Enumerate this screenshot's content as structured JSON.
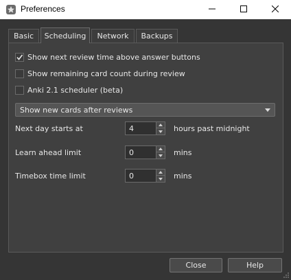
{
  "window": {
    "title": "Preferences",
    "icon": "anki-app-icon",
    "controls": [
      "minimize-icon",
      "maximize-icon",
      "close-icon"
    ]
  },
  "tabs": [
    {
      "label": "Basic",
      "active": false
    },
    {
      "label": "Scheduling",
      "active": true
    },
    {
      "label": "Network",
      "active": false
    },
    {
      "label": "Backups",
      "active": false
    }
  ],
  "scheduling": {
    "checkboxes": [
      {
        "label": "Show next review time above answer buttons",
        "checked": true
      },
      {
        "label": "Show remaining card count during review",
        "checked": false
      },
      {
        "label": "Anki 2.1 scheduler (beta)",
        "checked": false
      }
    ],
    "new_cards_order": {
      "selected": "Show new cards after reviews"
    },
    "fields": [
      {
        "label": "Next day starts at",
        "value": "4",
        "unit": "hours past midnight"
      },
      {
        "label": "Learn ahead limit",
        "value": "0",
        "unit": "mins"
      },
      {
        "label": "Timebox time limit",
        "value": "0",
        "unit": "mins"
      }
    ]
  },
  "buttons": {
    "close": "Close",
    "help": "Help"
  },
  "colors": {
    "background": "#353535",
    "panel": "#404040",
    "titlebar": "#ffffff"
  }
}
